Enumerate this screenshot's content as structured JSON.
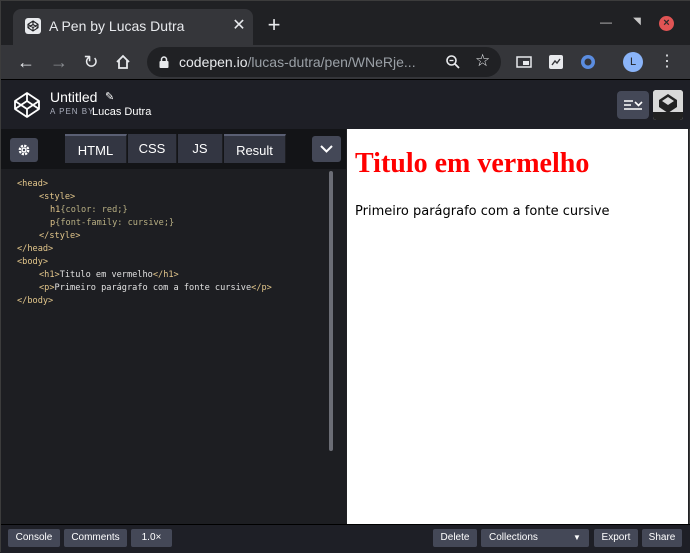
{
  "browser": {
    "tab_title": "A Pen by Lucas Dutra",
    "close_glyph": "✕",
    "new_tab_glyph": "+",
    "url_host": "codepen.io",
    "url_path": "/lucas-dutra/pen/WNeRje...",
    "profile_initial": "L"
  },
  "header": {
    "pen_title": "Untitled",
    "pen_by": "A PEN BY",
    "author": "Lucas Dutra"
  },
  "editor": {
    "tabs": [
      "HTML",
      "CSS",
      "JS",
      "Result"
    ],
    "code": {
      "l1": "<head>",
      "l2": "<style>",
      "l3a": "h1",
      "l3b": "{color: red;}",
      "l4a": "p",
      "l4b": "{font-family: cursive;}",
      "l5": "</style>",
      "l6": "</head>",
      "l7": "<body>",
      "l8a": "<h1>",
      "l8b": "Titulo em vermelho",
      "l8c": "</h1>",
      "l9a": "<p>",
      "l9b": "Primeiro parágrafo com a fonte cursive",
      "l9c": "</p>",
      "l10": "</body>"
    }
  },
  "result": {
    "heading": "Titulo em vermelho",
    "paragraph": "Primeiro parágrafo com a fonte cursive",
    "heading_color": "#ff0000"
  },
  "footer": {
    "console": "Console",
    "comments": "Comments",
    "zoom": "1.0×",
    "delete": "Delete",
    "collections": "Collections",
    "export": "Export",
    "share": "Share"
  },
  "icons": [
    "codepen-logo-icon",
    "back-icon",
    "forward-icon",
    "reload-icon",
    "home-icon",
    "lock-icon",
    "zoom-icon",
    "star-icon",
    "gear-icon",
    "chevron-down-icon",
    "layout-icon"
  ]
}
